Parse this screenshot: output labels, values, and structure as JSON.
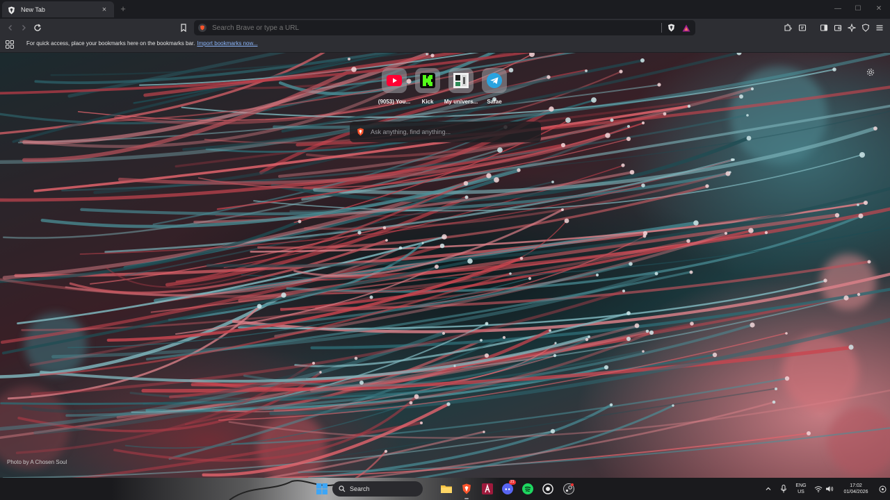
{
  "browser": {
    "tab": {
      "title": "New Tab",
      "close_glyph": "×",
      "icon": "brave-shield-icon"
    },
    "new_tab_glyph": "+",
    "window_controls": {
      "minimize": "—",
      "maximize": "☐",
      "close": "✕"
    },
    "omnibox": {
      "placeholder": "Search Brave or type a URL",
      "value": ""
    },
    "bookmarks_bar": {
      "message": "For quick access, place your bookmarks here on the bookmarks bar.",
      "import_link": "Import bookmarks now..."
    }
  },
  "ntp": {
    "top_sites": [
      {
        "label": "(9053) You...",
        "icon": "youtube-icon",
        "color": "#ff0033"
      },
      {
        "label": "Kick",
        "icon": "kick-icon",
        "color": "#53fc18"
      },
      {
        "label": "My univers...",
        "icon": "university-icon",
        "color": "#2f4f4f"
      },
      {
        "label": "Safae",
        "icon": "telegram-icon",
        "color": "#2aa3df"
      }
    ],
    "search": {
      "placeholder": "Ask anything, find anything..."
    },
    "photo_credit": "Photo by A Chosen Soul"
  },
  "taskbar": {
    "search_label": "Search",
    "language": {
      "line1": "ENG",
      "line2": "US"
    },
    "clock": {
      "time": "17:02",
      "date": "01/04/2026"
    },
    "discord_badge": "21"
  },
  "colors": {
    "brave_orange": "#fb542b",
    "chrome_dark": "#1b1c20",
    "toolbar": "#2d2e33",
    "link": "#8ab4f8"
  }
}
